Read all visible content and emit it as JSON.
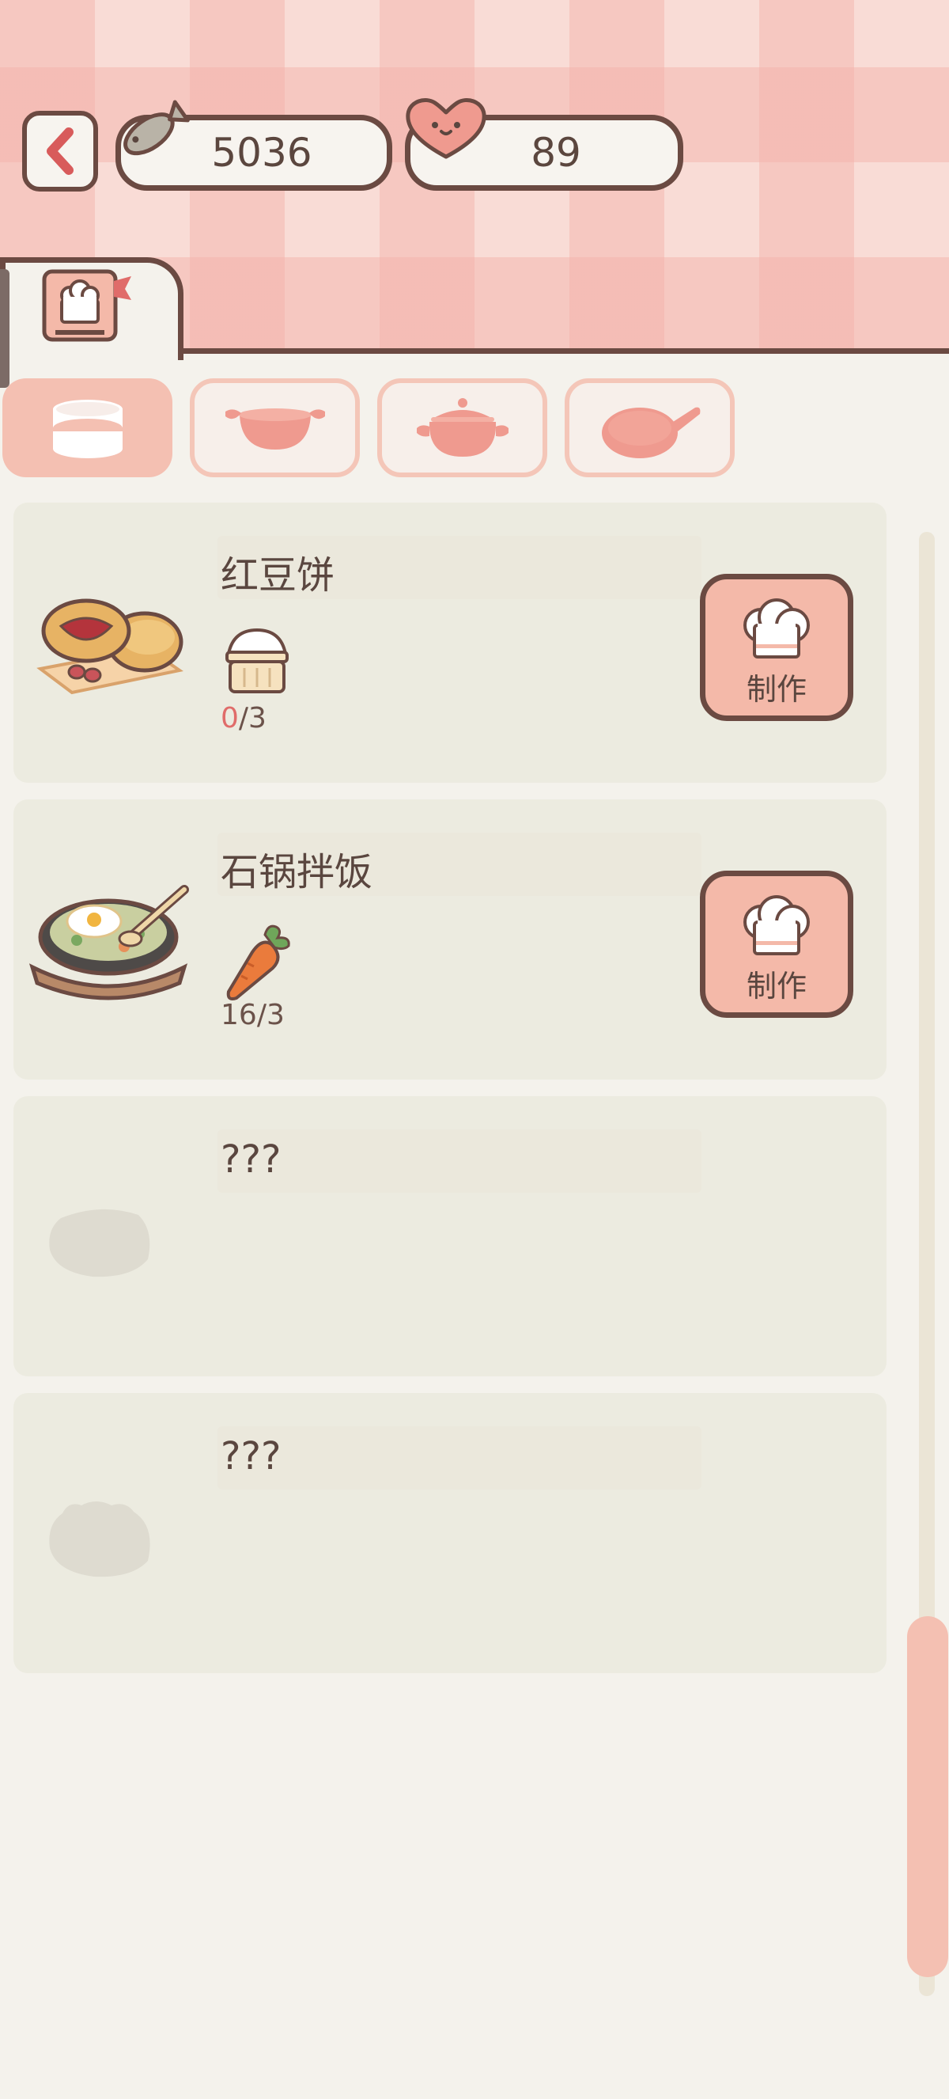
{
  "currency": {
    "fish_icon": "fish-icon",
    "fish_value": "5036",
    "heart_icon": "heart-icon",
    "heart_value": "89"
  },
  "tabs": [
    {
      "icon": "recipe-book-icon",
      "active": true
    }
  ],
  "categories": [
    {
      "icon": "steamer-icon",
      "active": true
    },
    {
      "icon": "wok-icon",
      "active": false
    },
    {
      "icon": "pot-icon",
      "active": false
    },
    {
      "icon": "frying-pan-icon",
      "active": false
    }
  ],
  "recipes": [
    {
      "name": "红豆饼",
      "image": "red-bean-cake-icon",
      "ingredient_icon": "steamed-bun-icon",
      "have": "0",
      "need": "3",
      "action": "制作",
      "locked": false
    },
    {
      "name": "石锅拌饭",
      "image": "bibimbap-icon",
      "ingredient_icon": "carrot-icon",
      "have": "16",
      "need": "3",
      "action": "制作",
      "locked": false
    },
    {
      "name": "???",
      "image": "locked-dish-silhouette",
      "locked": true
    },
    {
      "name": "???",
      "image": "locked-dish-silhouette",
      "locked": true
    }
  ],
  "colors": {
    "accent": "#f4b9a9",
    "outline": "#6b4a42",
    "card": "#ecebe0",
    "background": "#f4f2ec",
    "warning": "#e06c6a"
  }
}
